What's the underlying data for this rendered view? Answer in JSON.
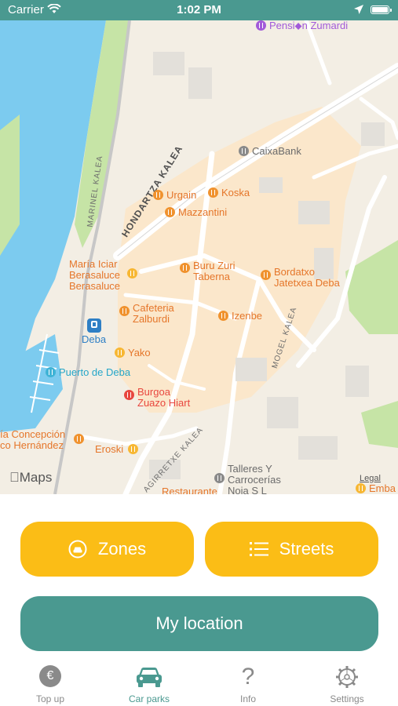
{
  "status_bar": {
    "carrier": "Carrier",
    "time": "1:02 PM"
  },
  "map": {
    "pois": {
      "pension": "Pensi⬥n Zumardi",
      "caixabank": "CaixaBank",
      "urgain": "Urgain",
      "koska": "Koska",
      "mazzantini": "Mazzantini",
      "maria_iciar": "María Iciar\nBerasaluce\nBerasaluce",
      "buru_zuri": "Buru Zuri\nTaberna",
      "bordatxo": "Bordatxo\nJatetxea Deba",
      "cafeteria": "Cafeteria\nZalburdi",
      "izenbe": "Izenbe",
      "deba_station": "Deba",
      "yako": "Yako",
      "puerto": "Puerto de Deba",
      "burgoa": "Burgoa\nZuazo Hiart",
      "concepcion": "ía Concepción\nco Hernández",
      "eroski": "Eroski",
      "talleres": "Talleres Y\nCarrocerías\nNoia S L",
      "restaurante": "Restaurante",
      "emba": "Emba"
    },
    "streets": {
      "hondartza": "HONDARTZA KALEA",
      "marinel": "MARINEL KALEA",
      "mogel": "MOGEL KALEA",
      "agirretxe": "AGIRRETXE KALEA"
    },
    "attribution": "Maps",
    "legal": "Legal"
  },
  "buttons": {
    "zones": "Zones",
    "streets": "Streets",
    "my_location": "My location"
  },
  "tabs": [
    {
      "label": "Top up",
      "icon": "euro-coin-icon"
    },
    {
      "label": "Car parks",
      "icon": "car-icon"
    },
    {
      "label": "Info",
      "icon": "question-mark-icon"
    },
    {
      "label": "Settings",
      "icon": "gear-icon"
    }
  ],
  "colors": {
    "teal": "#4a9990",
    "yellow": "#fbbd16",
    "water": "#7ccbef",
    "park": "#c6e4a6"
  }
}
